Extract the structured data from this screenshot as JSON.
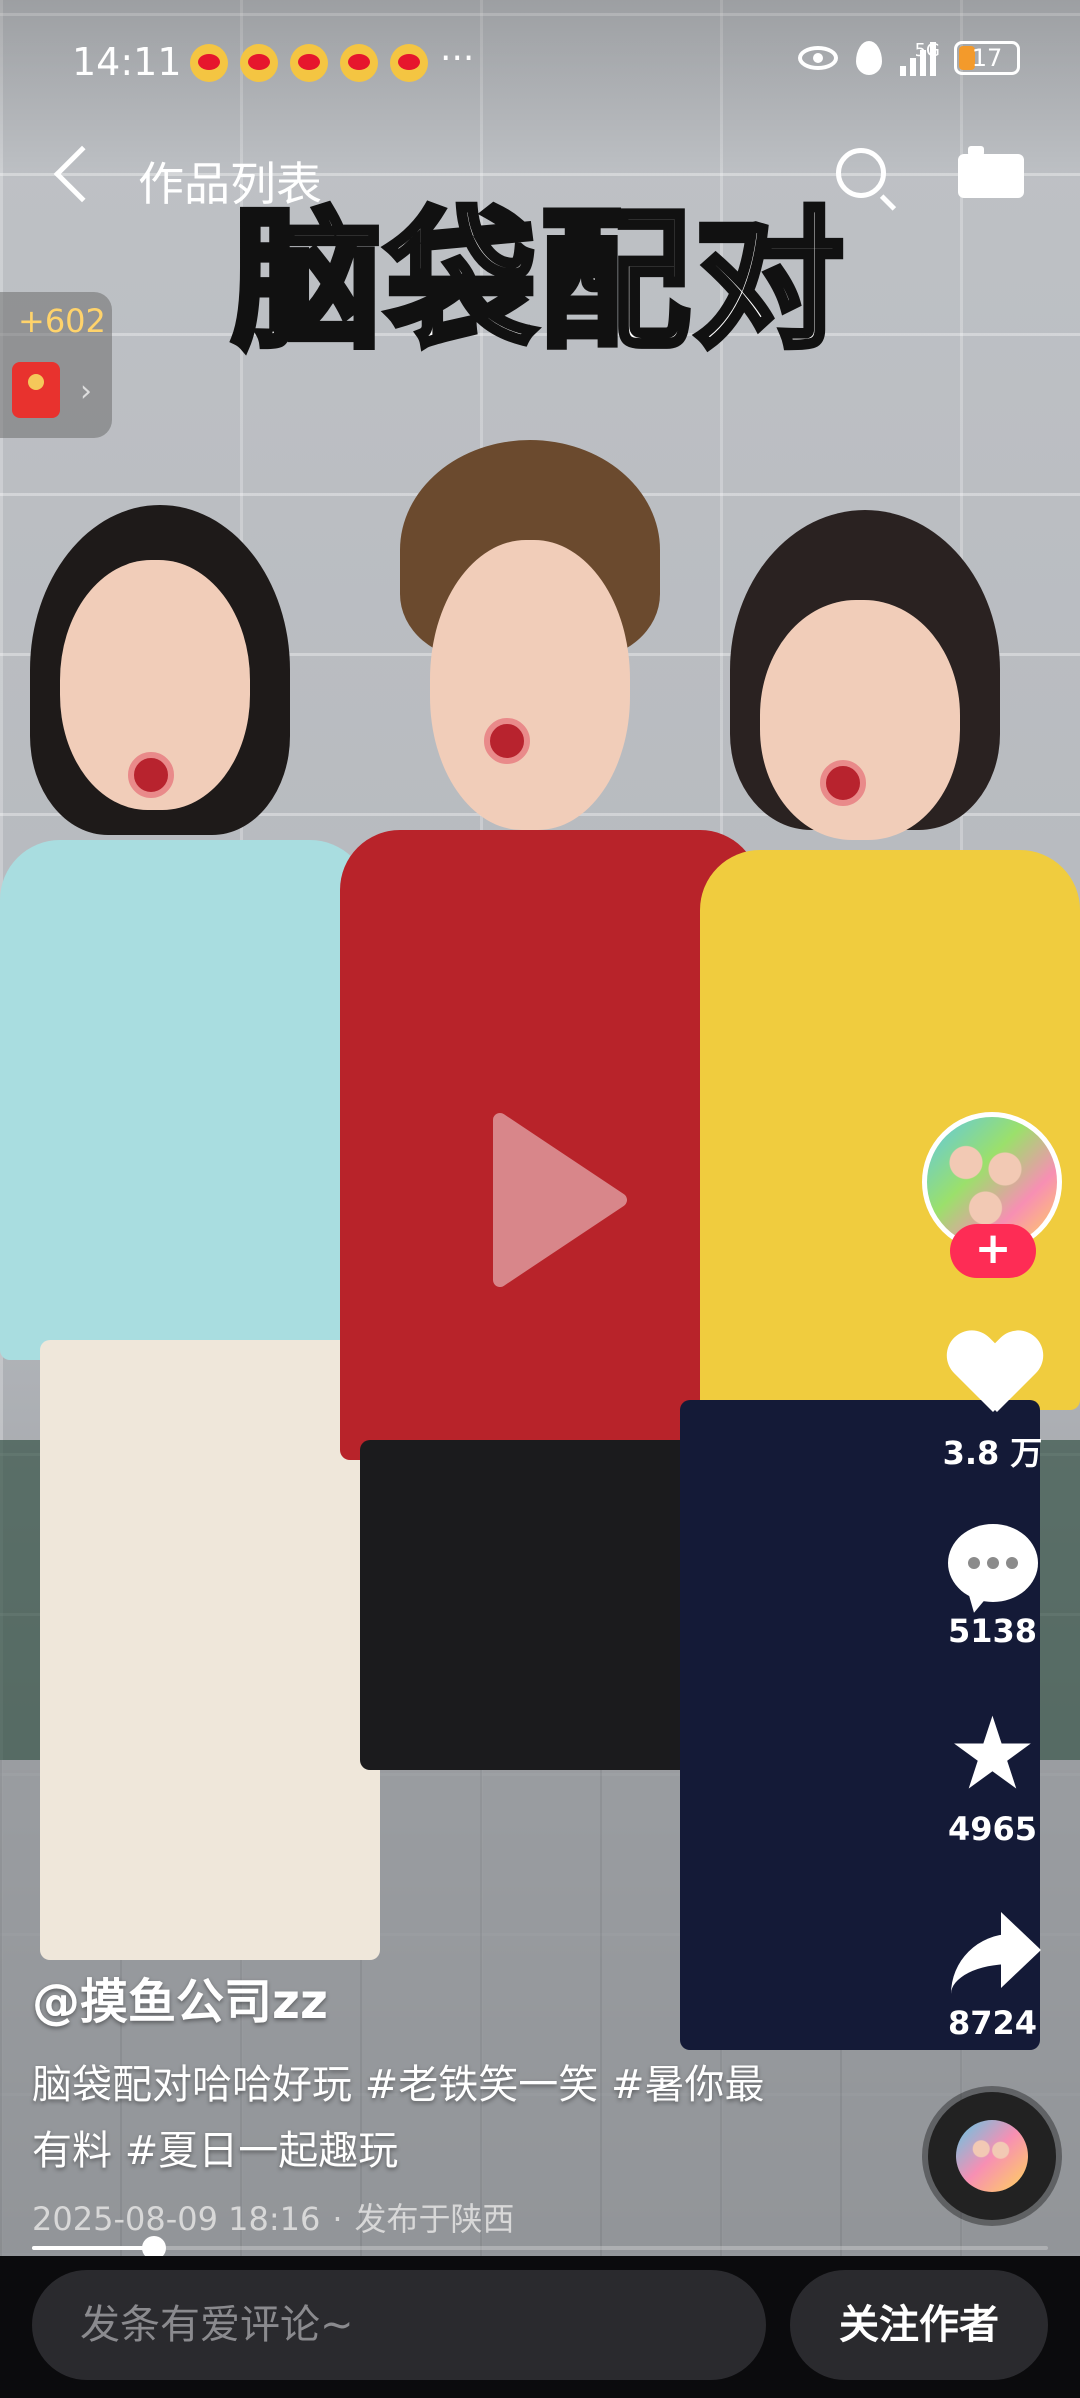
{
  "status_bar": {
    "time": "14:11",
    "notification_icons": [
      "weibo-icon",
      "weibo-icon",
      "weibo-icon",
      "weibo-icon",
      "weibo-icon"
    ],
    "overflow": "···",
    "network": "5G",
    "battery_level": "17",
    "battery_color": "#f39a2b"
  },
  "nav": {
    "title": "作品列表"
  },
  "video": {
    "overlay_title": "脑袋配对"
  },
  "red_packet": {
    "amount": "+602"
  },
  "actions": {
    "likes": "3.8 万",
    "comments": "5138",
    "favorites": "4965",
    "shares": "8724"
  },
  "post": {
    "author": "@摸鱼公司zz",
    "caption": "脑袋配对哈哈好玩 #老铁笑一笑 #暑你最有料 #夏日一起趣玩",
    "date": "2025-08-09 18:16",
    "separator": "·",
    "location": "发布于陕西",
    "progress": 0.12
  },
  "bottom": {
    "comment_placeholder": "发条有爱评论~",
    "follow_label": "关注作者"
  },
  "colors": {
    "accent": "#fe2c55",
    "bottom_bg": "#0b0b0d"
  }
}
